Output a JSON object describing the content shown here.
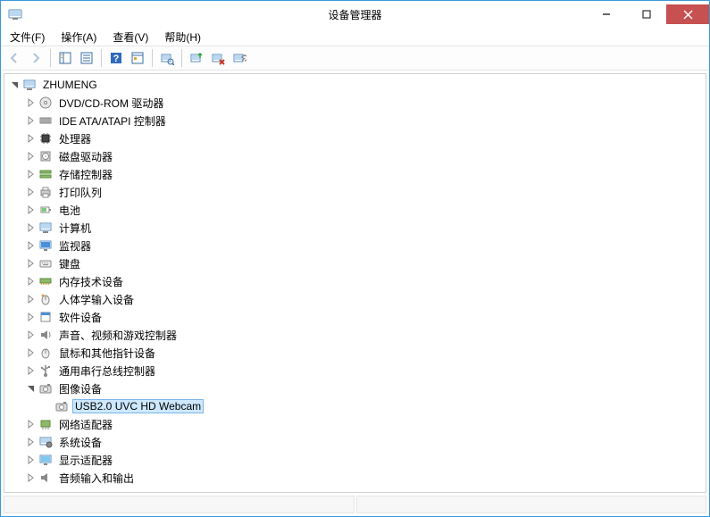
{
  "window": {
    "title": "设备管理器"
  },
  "menu": {
    "file": "文件(F)",
    "action": "操作(A)",
    "view": "查看(V)",
    "help": "帮助(H)"
  },
  "tree": {
    "root": "ZHUMENG",
    "items": [
      {
        "label": "DVD/CD-ROM 驱动器",
        "icon": "disc"
      },
      {
        "label": "IDE ATA/ATAPI 控制器",
        "icon": "ide"
      },
      {
        "label": "处理器",
        "icon": "cpu"
      },
      {
        "label": "磁盘驱动器",
        "icon": "disk"
      },
      {
        "label": "存储控制器",
        "icon": "storage"
      },
      {
        "label": "打印队列",
        "icon": "printer"
      },
      {
        "label": "电池",
        "icon": "battery"
      },
      {
        "label": "计算机",
        "icon": "computer"
      },
      {
        "label": "监视器",
        "icon": "monitor"
      },
      {
        "label": "键盘",
        "icon": "keyboard"
      },
      {
        "label": "内存技术设备",
        "icon": "memory"
      },
      {
        "label": "人体学输入设备",
        "icon": "hid"
      },
      {
        "label": "软件设备",
        "icon": "software"
      },
      {
        "label": "声音、视频和游戏控制器",
        "icon": "sound"
      },
      {
        "label": "鼠标和其他指针设备",
        "icon": "mouse"
      },
      {
        "label": "通用串行总线控制器",
        "icon": "usb"
      },
      {
        "label": "图像设备",
        "icon": "camera",
        "expanded": true,
        "children": [
          {
            "label": "USB2.0 UVC HD Webcam",
            "icon": "camera",
            "selected": true
          }
        ]
      },
      {
        "label": "网络适配器",
        "icon": "network"
      },
      {
        "label": "系统设备",
        "icon": "system"
      },
      {
        "label": "显示适配器",
        "icon": "display"
      },
      {
        "label": "音频输入和输出",
        "icon": "audio"
      }
    ]
  }
}
